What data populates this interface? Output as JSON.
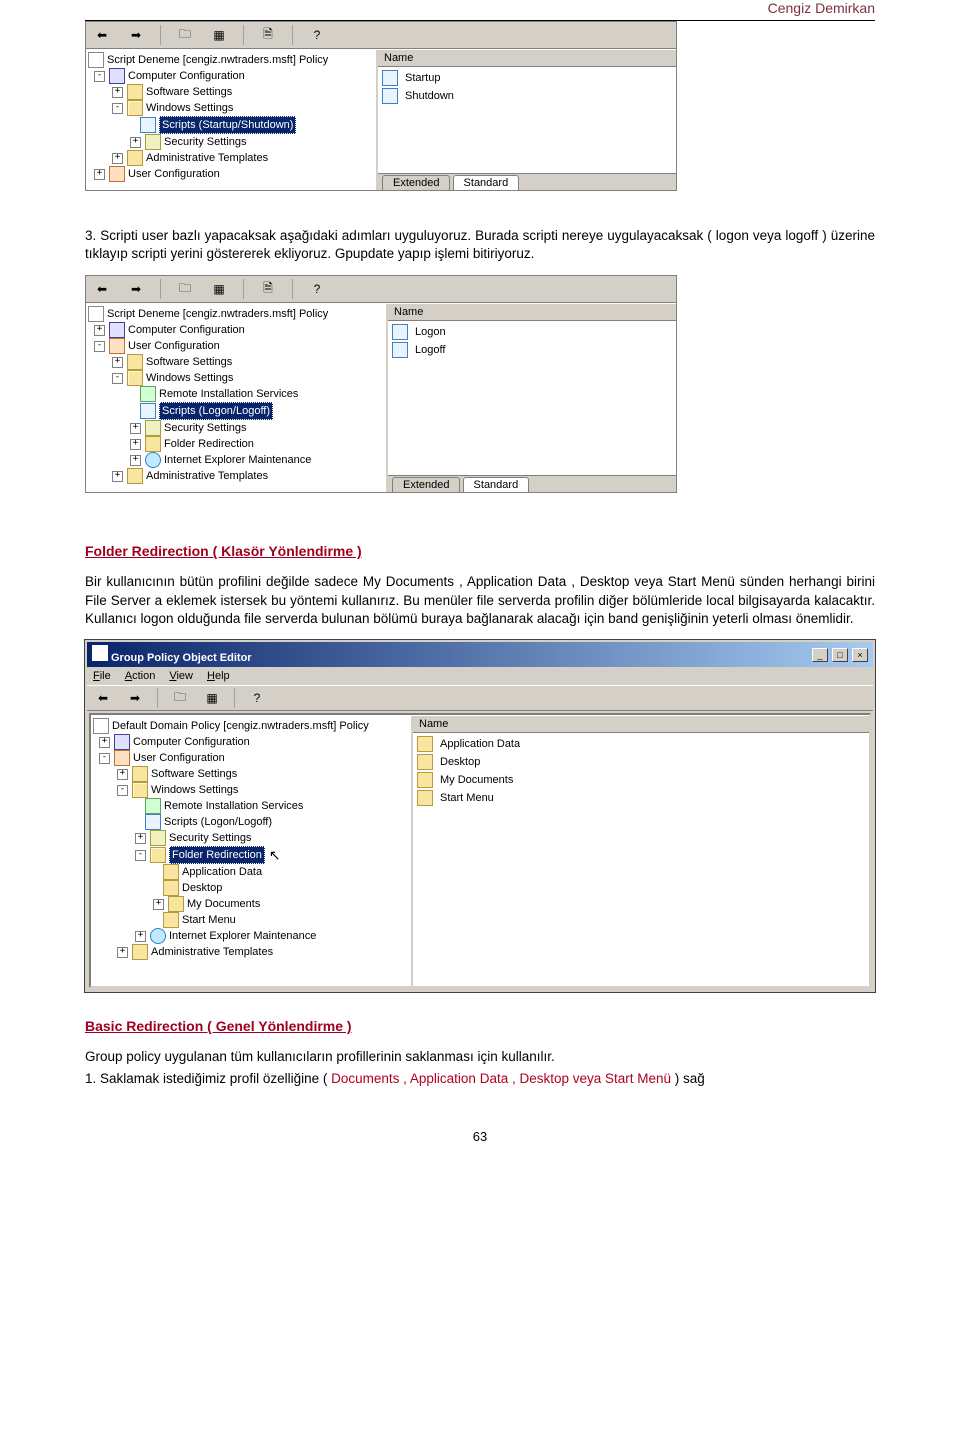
{
  "header": {
    "author": "Cengiz Demirkan"
  },
  "mmc1": {
    "name_col": "Name",
    "tree": {
      "root": "Script Deneme [cengiz.nwtraders.msft] Policy",
      "comp": "Computer Configuration",
      "soft": "Software Settings",
      "win": "Windows Settings",
      "scripts": "Scripts (Startup/Shutdown)",
      "sec": "Security Settings",
      "admin": "Administrative Templates",
      "user": "User Configuration"
    },
    "list": [
      "Startup",
      "Shutdown"
    ],
    "tabs": {
      "ext": "Extended",
      "std": "Standard"
    }
  },
  "para1": "3. Scripti user bazlı yapacaksak aşağıdaki adımları uyguluyoruz. Burada scripti nereye uygulayacaksak ( logon veya logoff ) üzerine tıklayıp scripti yerini göstererek ekliyoruz. Gpupdate yapıp işlemi bitiriyoruz.",
  "mmc2": {
    "name_col": "Name",
    "tree": {
      "root": "Script Deneme [cengiz.nwtraders.msft] Policy",
      "comp": "Computer Configuration",
      "user": "User Configuration",
      "soft": "Software Settings",
      "win": "Windows Settings",
      "remote": "Remote Installation Services",
      "scripts": "Scripts (Logon/Logoff)",
      "sec": "Security Settings",
      "folder": "Folder Redirection",
      "ie": "Internet Explorer Maintenance",
      "admin": "Administrative Templates"
    },
    "list": [
      "Logon",
      "Logoff"
    ],
    "tabs": {
      "ext": "Extended",
      "std": "Standard"
    }
  },
  "heading1": "Folder Redirection ( Klasör Yönlendirme )",
  "para2": "Bir kullanıcının bütün profilini değilde sadece My Documents , Application Data , Desktop veya Start Menü sünden herhangi birini File Server a eklemek istersek bu yöntemi kullanırız. Bu menüler file serverda profilin diğer bölümleride local bilgisayarda kalacaktır. Kullanıcı logon olduğunda file serverda bulunan bölümü buraya bağlanarak alacağı için band genişliğinin yeterli olması önemlidir.",
  "gpo": {
    "title": "Group Policy Object Editor",
    "menu": {
      "file": "File",
      "action": "Action",
      "view": "View",
      "help": "Help"
    },
    "name_col": "Name",
    "tree": {
      "root": "Default Domain Policy [cengiz.nwtraders.msft] Policy",
      "comp": "Computer Configuration",
      "user": "User Configuration",
      "soft": "Software Settings",
      "win": "Windows Settings",
      "remote": "Remote Installation Services",
      "scripts": "Scripts (Logon/Logoff)",
      "sec": "Security Settings",
      "folder": "Folder Redirection",
      "appdata": "Application Data",
      "desktop": "Desktop",
      "mydocs": "My Documents",
      "start": "Start Menu",
      "ie": "Internet Explorer Maintenance",
      "admin": "Administrative Templates"
    },
    "list": [
      "Application Data",
      "Desktop",
      "My Documents",
      "Start Menu"
    ]
  },
  "heading2": "Basic Redirection ( Genel Yönlendirme )",
  "para3a": "Group policy uygulanan tüm kullanıcıların profillerinin saklanması için kullanılır.",
  "para3b_pre": "1. Saklamak istediğimiz profil özelliğine ( ",
  "para3b_red": "Documents , Application Data , Desktop veya Start Menü",
  "para3b_post": " ) sağ",
  "pagenum": "63"
}
